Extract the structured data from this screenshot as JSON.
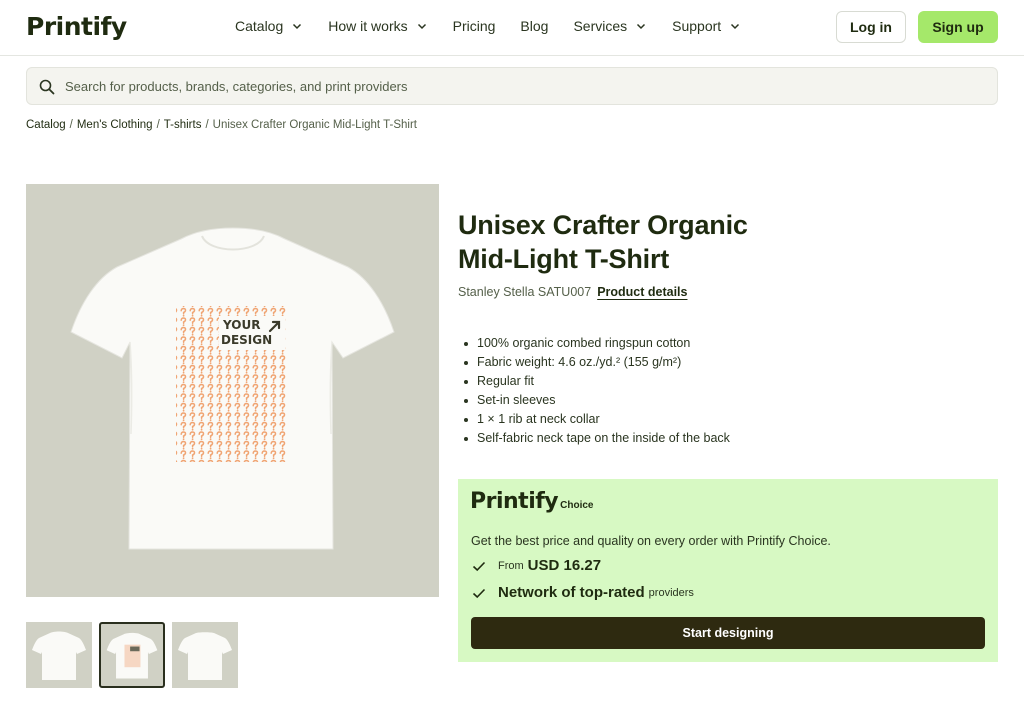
{
  "header": {
    "logo": "Printify",
    "nav": [
      {
        "label": "Catalog",
        "has_dropdown": true
      },
      {
        "label": "How it works",
        "has_dropdown": true
      },
      {
        "label": "Pricing",
        "has_dropdown": false
      },
      {
        "label": "Blog",
        "has_dropdown": false
      },
      {
        "label": "Services",
        "has_dropdown": true
      },
      {
        "label": "Support",
        "has_dropdown": true
      }
    ],
    "login_label": "Log in",
    "signup_label": "Sign up"
  },
  "search": {
    "placeholder": "Search for products, brands, categories, and print providers",
    "icon": "search-icon"
  },
  "breadcrumb": [
    "Catalog",
    "Men's Clothing",
    "T-shirts",
    "Unisex Crafter Organic Mid-Light T-Shirt"
  ],
  "product": {
    "title_line1": "Unisex Crafter Organic",
    "title_line2": "Mid-Light T-Shirt",
    "brand_sku": "Stanley Stella SATU007",
    "details_link": "Product details",
    "features": [
      "100% organic combed ringspun cotton",
      "Fabric weight: 4.6 oz./yd.² (155 g/m²)",
      "Regular fit",
      "Set-in sleeves",
      "1 × 1 rib at neck collar",
      "Self-fabric neck tape on the inside of the back"
    ],
    "design_text_line1": "YOUR",
    "design_text_line2": "DESIGN"
  },
  "choice": {
    "brand": "Printify",
    "suffix": "Choice",
    "description": "Get the best price and quality on every order with Printify Choice.",
    "price_prefix": "From",
    "price": "USD 16.27",
    "network_main": "Network of top-rated",
    "network_suffix": "providers",
    "cta": "Start designing"
  },
  "colors": {
    "image_bg": "#d0d1c5",
    "choice_bg": "#d7f9c3",
    "signup_bg": "#a5e86a",
    "cta_bg": "#2e2a10",
    "pattern_orange": "#f0a574",
    "text_dark": "#1f2b10"
  }
}
